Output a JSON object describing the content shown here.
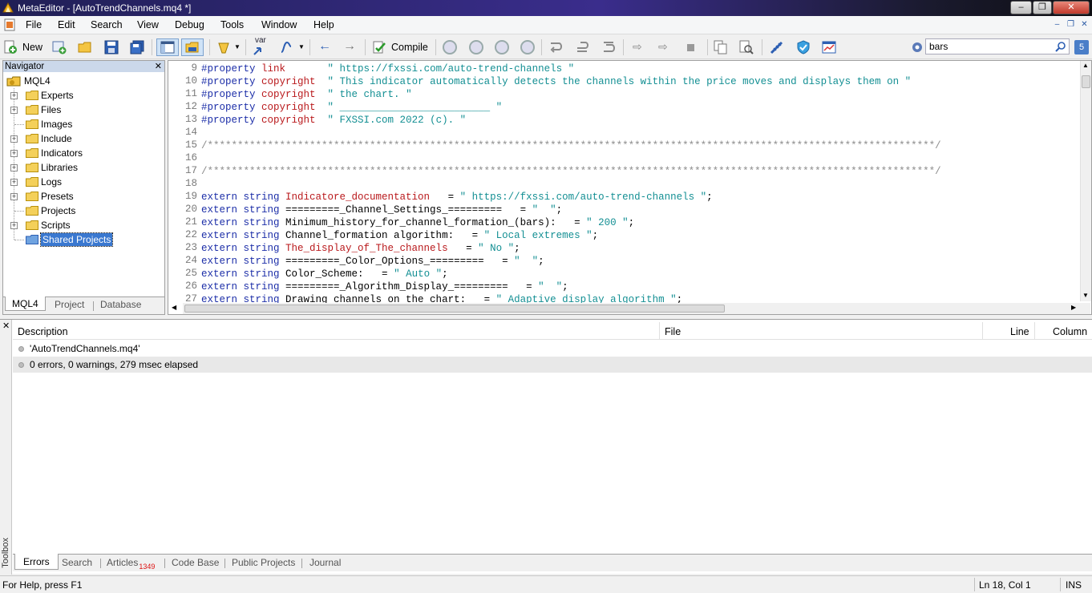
{
  "window": {
    "title": "MetaEditor - [AutoTrendChannels.mq4 *]"
  },
  "menu": [
    "File",
    "Edit",
    "Search",
    "View",
    "Debug",
    "Tools",
    "Window",
    "Help"
  ],
  "toolbar": {
    "new_label": "New",
    "compile_label": "Compile",
    "var_label": "var",
    "search_value": "bars",
    "search_badge": "5"
  },
  "navigator": {
    "title": "Navigator",
    "root": "MQL4",
    "items": [
      "Experts",
      "Files",
      "Images",
      "Include",
      "Indicators",
      "Libraries",
      "Logs",
      "Presets",
      "Projects",
      "Scripts",
      "Shared Projects"
    ],
    "tabs": [
      "MQL4",
      "Project",
      "Database"
    ]
  },
  "editor": {
    "lines": [
      {
        "num": "9",
        "parts": [
          [
            "kw",
            "#property "
          ],
          [
            "pr",
            "link"
          ],
          [
            "id",
            "       "
          ],
          [
            "st",
            "\" https://fxssi.com/auto-trend-channels \""
          ]
        ]
      },
      {
        "num": "10",
        "parts": [
          [
            "kw",
            "#property "
          ],
          [
            "pr",
            "copyright"
          ],
          [
            "id",
            "  "
          ],
          [
            "st",
            "\" This indicator automatically detects the channels within the price moves and displays them on \""
          ]
        ]
      },
      {
        "num": "11",
        "parts": [
          [
            "kw",
            "#property "
          ],
          [
            "pr",
            "copyright"
          ],
          [
            "id",
            "  "
          ],
          [
            "st",
            "\" the chart. \""
          ]
        ]
      },
      {
        "num": "12",
        "parts": [
          [
            "kw",
            "#property "
          ],
          [
            "pr",
            "copyright"
          ],
          [
            "id",
            "  "
          ],
          [
            "st",
            "\" _________________________ \""
          ]
        ]
      },
      {
        "num": "13",
        "parts": [
          [
            "kw",
            "#property "
          ],
          [
            "pr",
            "copyright"
          ],
          [
            "id",
            "  "
          ],
          [
            "st",
            "\" FXSSI.com 2022 (c). \""
          ]
        ]
      },
      {
        "num": "14",
        "parts": []
      },
      {
        "num": "15",
        "parts": [
          [
            "cm",
            "/*************************************************************************************************************************/"
          ]
        ]
      },
      {
        "num": "16",
        "parts": []
      },
      {
        "num": "17",
        "parts": [
          [
            "cm",
            "/*************************************************************************************************************************/"
          ]
        ]
      },
      {
        "num": "18",
        "parts": []
      },
      {
        "num": "19",
        "parts": [
          [
            "kw",
            "extern string "
          ],
          [
            "pr",
            "Indicatore_documentation"
          ],
          [
            "id",
            "   = "
          ],
          [
            "st",
            "\" https://fxssi.com/auto-trend-channels \""
          ],
          [
            "id",
            ";"
          ]
        ]
      },
      {
        "num": "20",
        "parts": [
          [
            "kw",
            "extern string "
          ],
          [
            "id",
            "=========_Channel_Settings_=========   = "
          ],
          [
            "st",
            "\"  \""
          ],
          [
            "id",
            ";"
          ]
        ]
      },
      {
        "num": "21",
        "parts": [
          [
            "kw",
            "extern string "
          ],
          [
            "id",
            "Minimum_history_for_channel_formation_(bars):   = "
          ],
          [
            "st",
            "\" 200 \""
          ],
          [
            "id",
            ";"
          ]
        ]
      },
      {
        "num": "22",
        "parts": [
          [
            "kw",
            "extern string "
          ],
          [
            "id",
            "Channel_formation algorithm:   = "
          ],
          [
            "st",
            "\" Local extremes \""
          ],
          [
            "id",
            ";"
          ]
        ]
      },
      {
        "num": "23",
        "parts": [
          [
            "kw",
            "extern string "
          ],
          [
            "pr",
            "The_display_of_The_channels"
          ],
          [
            "id",
            "   = "
          ],
          [
            "st",
            "\" No \""
          ],
          [
            "id",
            ";"
          ]
        ]
      },
      {
        "num": "24",
        "parts": [
          [
            "kw",
            "extern string "
          ],
          [
            "id",
            "=========_Color_Options_=========   = "
          ],
          [
            "st",
            "\"  \""
          ],
          [
            "id",
            ";"
          ]
        ]
      },
      {
        "num": "25",
        "parts": [
          [
            "kw",
            "extern string "
          ],
          [
            "id",
            "Color_Scheme:   = "
          ],
          [
            "st",
            "\" Auto \""
          ],
          [
            "id",
            ";"
          ]
        ]
      },
      {
        "num": "26",
        "parts": [
          [
            "kw",
            "extern string "
          ],
          [
            "id",
            "=========_Algorithm_Display_=========   = "
          ],
          [
            "st",
            "\"  \""
          ],
          [
            "id",
            ";"
          ]
        ]
      },
      {
        "num": "27",
        "parts": [
          [
            "kw",
            "extern string "
          ],
          [
            "id",
            "Drawing channels on the chart:   = "
          ],
          [
            "st",
            "\" Adaptive display algorithm \""
          ],
          [
            "id",
            ";"
          ]
        ]
      }
    ]
  },
  "toolbox": {
    "side_label": "Toolbox",
    "columns": [
      "Description",
      "File",
      "Line",
      "Column"
    ],
    "messages": [
      "'AutoTrendChannels.mq4'",
      "0 errors, 0 warnings, 279 msec elapsed"
    ],
    "tabs": [
      {
        "label": "Errors",
        "badge": ""
      },
      {
        "label": "Search",
        "badge": ""
      },
      {
        "label": "Articles",
        "badge": "1349"
      },
      {
        "label": "Code Base",
        "badge": ""
      },
      {
        "label": "Public Projects",
        "badge": ""
      },
      {
        "label": "Journal",
        "badge": ""
      }
    ]
  },
  "status": {
    "help": "For Help, press F1",
    "position": "Ln 18, Col 1",
    "mode": "INS"
  }
}
